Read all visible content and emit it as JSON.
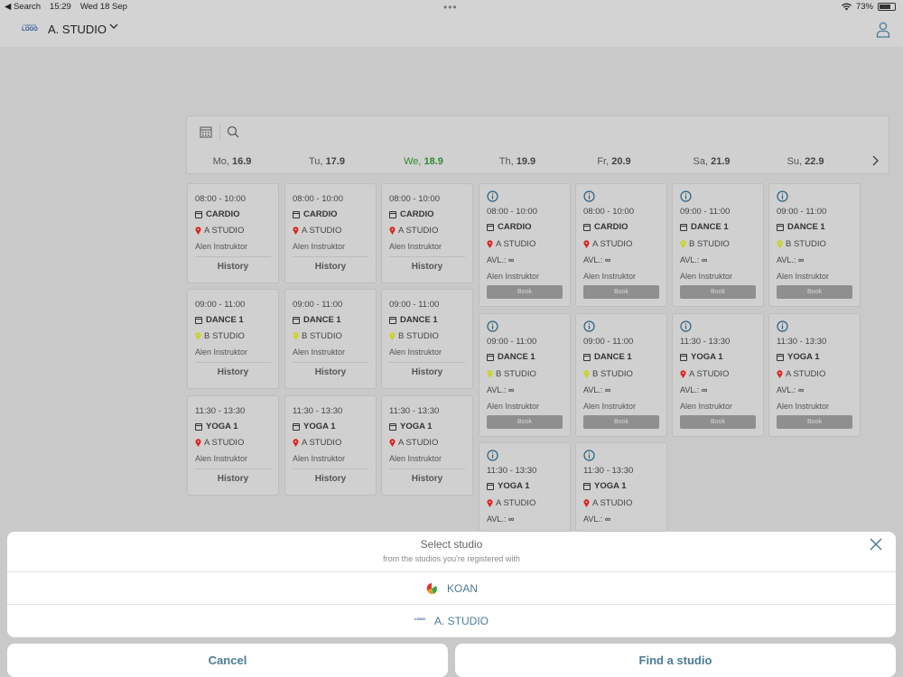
{
  "status_bar": {
    "back": "◀ Search",
    "time": "15:29",
    "date": "Wed 18 Sep",
    "battery": "73%"
  },
  "header": {
    "logo_top": "COMPANY",
    "logo_text": "LOGO",
    "studio": "A. STUDIO"
  },
  "week": [
    {
      "name": "Mo,",
      "date": "16.9"
    },
    {
      "name": "Tu,",
      "date": "17.9"
    },
    {
      "name": "We,",
      "date": "18.9"
    },
    {
      "name": "Th,",
      "date": "19.9"
    },
    {
      "name": "Fr,",
      "date": "20.9"
    },
    {
      "name": "Sa,",
      "date": "21.9"
    },
    {
      "name": "Su,",
      "date": "22.9"
    }
  ],
  "past_cards": [
    {
      "time": "08:00 - 10:00",
      "class": "CARDIO",
      "location": "A STUDIO",
      "instructor": "Alen Instruktor",
      "action": "History"
    },
    {
      "time": "08:00 - 10:00",
      "class": "CARDIO",
      "location": "A STUDIO",
      "instructor": "Alen Instruktor",
      "action": "History"
    },
    {
      "time": "08:00 - 10:00",
      "class": "CARDIO",
      "location": "A STUDIO",
      "instructor": "Alen Instruktor",
      "action": "History"
    },
    {
      "time": "09:00 - 11:00",
      "class": "DANCE 1",
      "location": "B STUDIO",
      "instructor": "Alen Instruktor",
      "action": "History"
    },
    {
      "time": "09:00 - 11:00",
      "class": "DANCE 1",
      "location": "B STUDIO",
      "instructor": "Alen Instruktor",
      "action": "History"
    },
    {
      "time": "09:00 - 11:00",
      "class": "DANCE 1",
      "location": "B STUDIO",
      "instructor": "Alen Instruktor",
      "action": "History"
    },
    {
      "time": "11:30 - 13:30",
      "class": "YOGA 1",
      "location": "A STUDIO",
      "instructor": "Alen Instruktor",
      "action": "History"
    },
    {
      "time": "11:30 - 13:30",
      "class": "YOGA 1",
      "location": "A STUDIO",
      "instructor": "Alen Instruktor",
      "action": "History"
    },
    {
      "time": "11:30 - 13:30",
      "class": "YOGA 1",
      "location": "A STUDIO",
      "instructor": "Alen Instruktor",
      "action": "History"
    }
  ],
  "future_cards": [
    {
      "time": "08:00 - 10:00",
      "class": "CARDIO",
      "location": "A STUDIO",
      "avl": "AVL.:",
      "avl_value": "∞",
      "instructor": "Alen Instruktor",
      "action": "Book"
    },
    {
      "time": "08:00 - 10:00",
      "class": "CARDIO",
      "location": "A STUDIO",
      "avl": "AVL.:",
      "avl_value": "∞",
      "instructor": "Alen Instruktor",
      "action": "Book"
    },
    {
      "time": "09:00 - 11:00",
      "class": "DANCE 1",
      "location": "B STUDIO",
      "avl": "AVL.:",
      "avl_value": "∞",
      "instructor": "Alen Instruktor",
      "action": "Book"
    },
    {
      "time": "09:00 - 11:00",
      "class": "DANCE 1",
      "location": "B STUDIO",
      "avl": "AVL.:",
      "avl_value": "∞",
      "instructor": "Alen Instruktor",
      "action": "Book"
    },
    {
      "time": "09:00 - 11:00",
      "class": "DANCE 1",
      "location": "B STUDIO",
      "avl": "AVL.:",
      "avl_value": "∞",
      "instructor": "Alen Instruktor",
      "action": "Book"
    },
    {
      "time": "09:00 - 11:00",
      "class": "DANCE 1",
      "location": "B STUDIO",
      "avl": "AVL.:",
      "avl_value": "∞",
      "instructor": "Alen Instruktor",
      "action": "Book"
    },
    {
      "time": "11:30 - 13:30",
      "class": "YOGA 1",
      "location": "A STUDIO",
      "avl": "AVL.:",
      "avl_value": "∞",
      "instructor": "Alen Instruktor",
      "action": "Book"
    },
    {
      "time": "11:30 - 13:30",
      "class": "YOGA 1",
      "location": "A STUDIO",
      "avl": "AVL.:",
      "avl_value": "∞",
      "instructor": "Alen Instruktor",
      "action": "Book"
    },
    {
      "time": "11:30 - 13:30",
      "class": "YOGA 1",
      "location": "A STUDIO",
      "avl": "AVL.:",
      "avl_value": "∞"
    },
    {
      "time": "11:30 - 13:30",
      "class": "YOGA 1",
      "location": "A STUDIO",
      "avl": "AVL.:",
      "avl_value": "∞"
    }
  ],
  "sheet": {
    "title": "Select studio",
    "subtitle": "from the studios you're registered with",
    "options": [
      {
        "label": "KOAN",
        "icon": "koan-logo-icon"
      },
      {
        "label": "A. STUDIO",
        "icon": "company-logo-icon"
      }
    ]
  },
  "buttons": {
    "cancel": "Cancel",
    "find": "Find a studio"
  },
  "colors": {
    "accent": "#4a7b96",
    "today": "#2e8b2e",
    "pin_a": "#e0201c",
    "pin_b": "#c8d41a"
  }
}
